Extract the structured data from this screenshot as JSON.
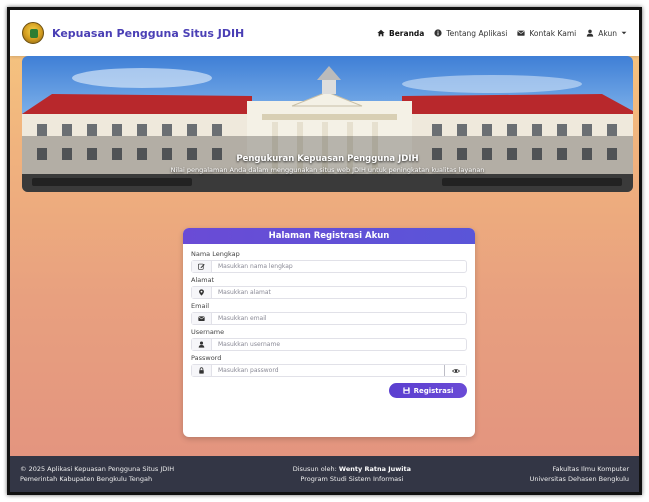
{
  "navbar": {
    "brand": "Kepuasan Pengguna Situs JDIH",
    "links": [
      {
        "label": "Beranda",
        "icon": "home-icon"
      },
      {
        "label": "Tentang Aplikasi",
        "icon": "info-icon"
      },
      {
        "label": "Kontak Kami",
        "icon": "envelope-icon"
      },
      {
        "label": "Akun",
        "icon": "user-icon"
      }
    ]
  },
  "hero": {
    "title": "Pengukuran Kepuasan Pengguna JDIH",
    "subtitle": "Nilai pengalaman Anda dalam menggunakan situs web JDIH untuk peningkatan kualitas layanan"
  },
  "form": {
    "title": "Halaman Registrasi Akun",
    "fields": [
      {
        "label": "Nama Lengkap",
        "placeholder": "Masukkan nama lengkap",
        "icon": "edit-icon"
      },
      {
        "label": "Alamat",
        "placeholder": "Masukkan alamat",
        "icon": "location-pin-icon"
      },
      {
        "label": "Email",
        "placeholder": "Masukkan email",
        "icon": "envelope-icon"
      },
      {
        "label": "Username",
        "placeholder": "Masukkan username",
        "icon": "user-icon"
      },
      {
        "label": "Password",
        "placeholder": "Masukkan password",
        "icon": "lock-icon"
      }
    ],
    "submit_label": "Registrasi"
  },
  "footer": {
    "left_line1": "© 2025 Aplikasi Kepuasan Pengguna Situs JDIH",
    "left_line2": "Pemerintah Kabupaten Bengkulu Tengah",
    "center_prefix": "Disusun oleh:",
    "center_author": "Wenty Ratna Juwita",
    "center_line2": "Program Studi Sistem Informasi",
    "right_line1": "Fakultas Ilmu Komputer",
    "right_line2": "Universitas Dehasen Bengkulu"
  },
  "colors": {
    "accent": "#5a4fd6",
    "footer_bg": "#333645",
    "page_gradient_top": "#f7c97f",
    "page_gradient_bottom": "#e2927f"
  }
}
